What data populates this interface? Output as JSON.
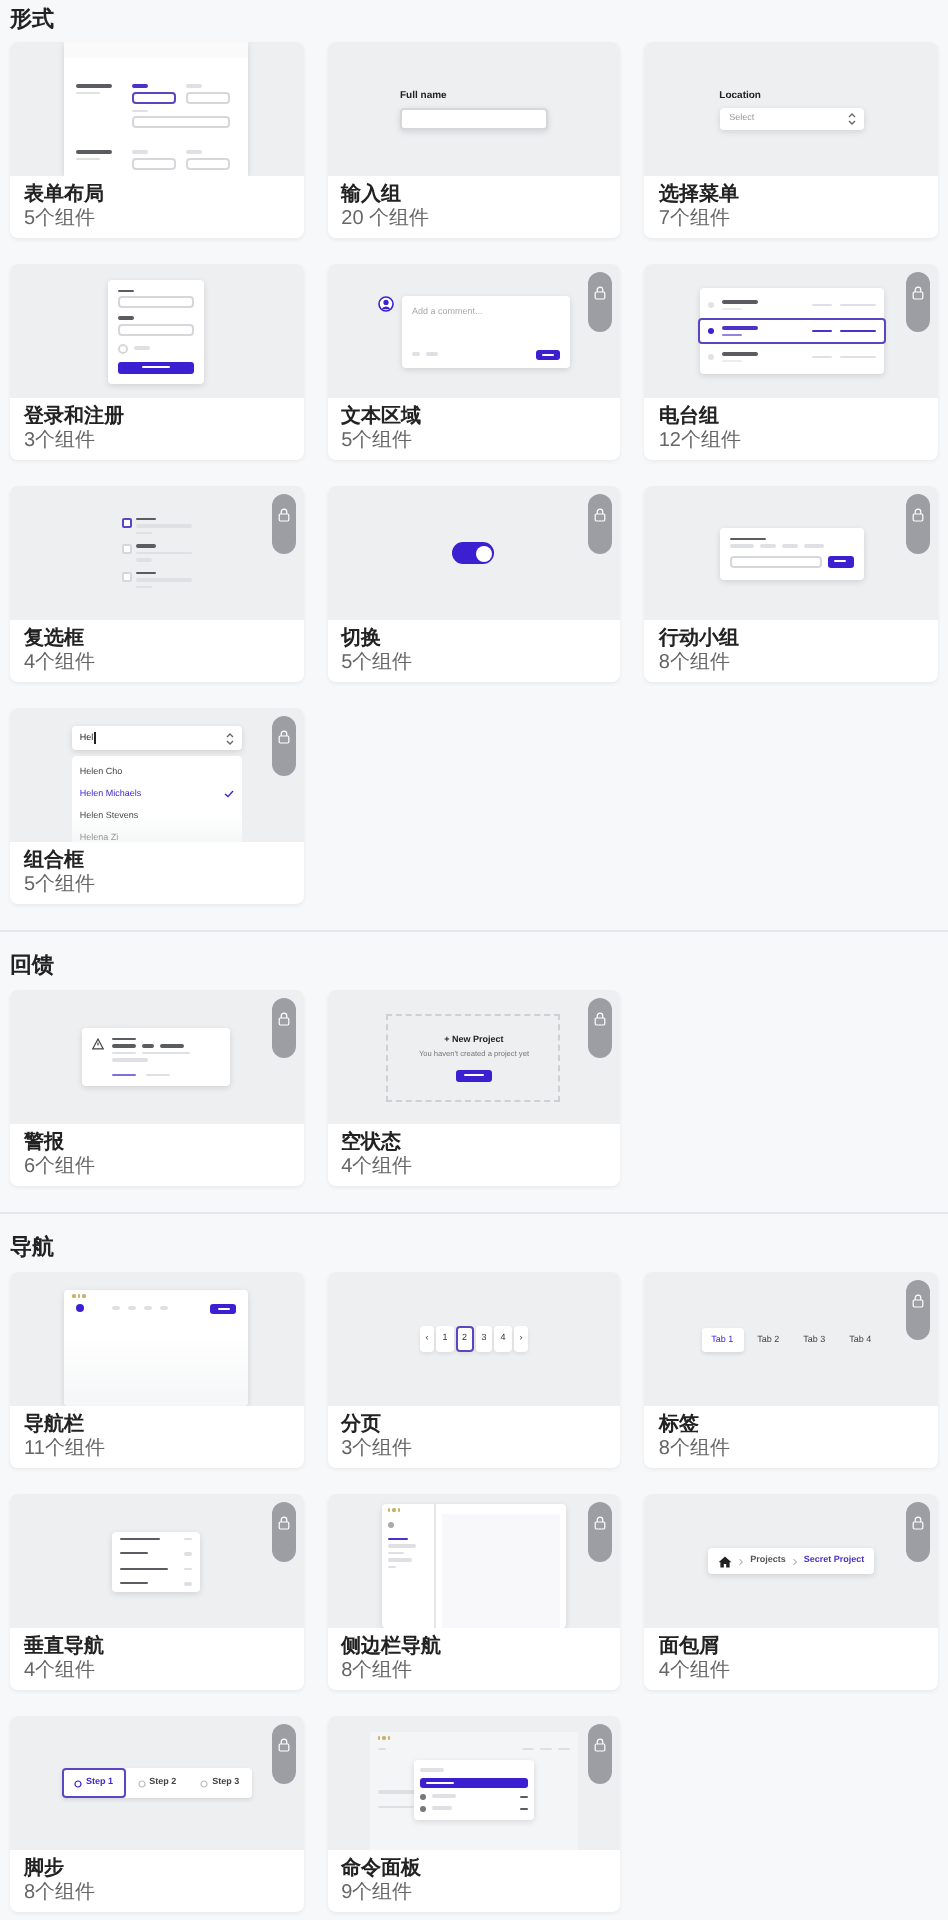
{
  "sections": [
    {
      "title": "形式",
      "cards": [
        {
          "title": "表单布局",
          "count": "5个组件",
          "locked": false,
          "preview": {
            "kind": "form_layout"
          }
        },
        {
          "title": "输入组",
          "count": "20 个组件",
          "locked": false,
          "preview": {
            "kind": "input",
            "label": "Full name"
          }
        },
        {
          "title": "选择菜单",
          "count": "7个组件",
          "locked": false,
          "preview": {
            "kind": "select",
            "label": "Location",
            "placeholder": "Select"
          }
        },
        {
          "title": "登录和注册",
          "count": "3个组件",
          "locked": false,
          "preview": {
            "kind": "login"
          }
        },
        {
          "title": "文本区域",
          "count": "5个组件",
          "locked": true,
          "preview": {
            "kind": "textarea",
            "placeholder": "Add a comment..."
          }
        },
        {
          "title": "电台组",
          "count": "12个组件",
          "locked": true,
          "preview": {
            "kind": "radio"
          }
        },
        {
          "title": "复选框",
          "count": "4个组件",
          "locked": true,
          "preview": {
            "kind": "checkbox"
          }
        },
        {
          "title": "切换",
          "count": "5个组件",
          "locked": true,
          "preview": {
            "kind": "toggle",
            "on": true
          }
        },
        {
          "title": "行动小组",
          "count": "8个组件",
          "locked": true,
          "preview": {
            "kind": "action"
          }
        },
        {
          "title": "组合框",
          "count": "5个组件",
          "locked": true,
          "preview": {
            "kind": "combobox",
            "value": "Hel",
            "options": [
              {
                "label": "Helen Cho",
                "selected": false
              },
              {
                "label": "Helen Michaels",
                "selected": true
              },
              {
                "label": "Helen Stevens",
                "selected": false
              },
              {
                "label": "Helena Zi",
                "selected": false
              }
            ]
          }
        }
      ]
    },
    {
      "title": "回馈",
      "cards": [
        {
          "title": "警报",
          "count": "6个组件",
          "locked": true,
          "preview": {
            "kind": "alert"
          }
        },
        {
          "title": "空状态",
          "count": "4个组件",
          "locked": true,
          "preview": {
            "kind": "empty_state",
            "heading": "+ New Project",
            "message": "You haven't created a project yet"
          }
        }
      ]
    },
    {
      "title": "导航",
      "cards": [
        {
          "title": "导航栏",
          "count": "11个组件",
          "locked": false,
          "preview": {
            "kind": "navbar"
          }
        },
        {
          "title": "分页",
          "count": "3个组件",
          "locked": false,
          "preview": {
            "kind": "pagination",
            "items": [
              {
                "label": "‹",
                "selected": false
              },
              {
                "label": "1",
                "selected": false
              },
              {
                "label": "2",
                "selected": true
              },
              {
                "label": "3",
                "selected": false
              },
              {
                "label": "4",
                "selected": false
              },
              {
                "label": "›",
                "selected": false
              }
            ]
          }
        },
        {
          "title": "标签",
          "count": "8个组件",
          "locked": true,
          "preview": {
            "kind": "tabs",
            "tabs": [
              {
                "label": "Tab 1",
                "selected": true
              },
              {
                "label": "Tab 2",
                "selected": false
              },
              {
                "label": "Tab 3",
                "selected": false
              },
              {
                "label": "Tab 4",
                "selected": false
              }
            ]
          }
        },
        {
          "title": "垂直导航",
          "count": "4个组件",
          "locked": true,
          "preview": {
            "kind": "vertical_nav"
          }
        },
        {
          "title": "侧边栏导航",
          "count": "8个组件",
          "locked": true,
          "preview": {
            "kind": "sidebar"
          }
        },
        {
          "title": "面包屑",
          "count": "4个组件",
          "locked": true,
          "preview": {
            "kind": "breadcrumb",
            "items": [
              "Projects",
              "Secret Project"
            ]
          }
        },
        {
          "title": "脚步",
          "count": "8个组件",
          "locked": true,
          "preview": {
            "kind": "steps",
            "steps": [
              {
                "label": "Step 1",
                "selected": true
              },
              {
                "label": "Step 2",
                "selected": false
              },
              {
                "label": "Step 3",
                "selected": false
              }
            ]
          }
        },
        {
          "title": "命令面板",
          "count": "9个组件",
          "locked": true,
          "preview": {
            "kind": "command_palette"
          }
        }
      ]
    }
  ]
}
